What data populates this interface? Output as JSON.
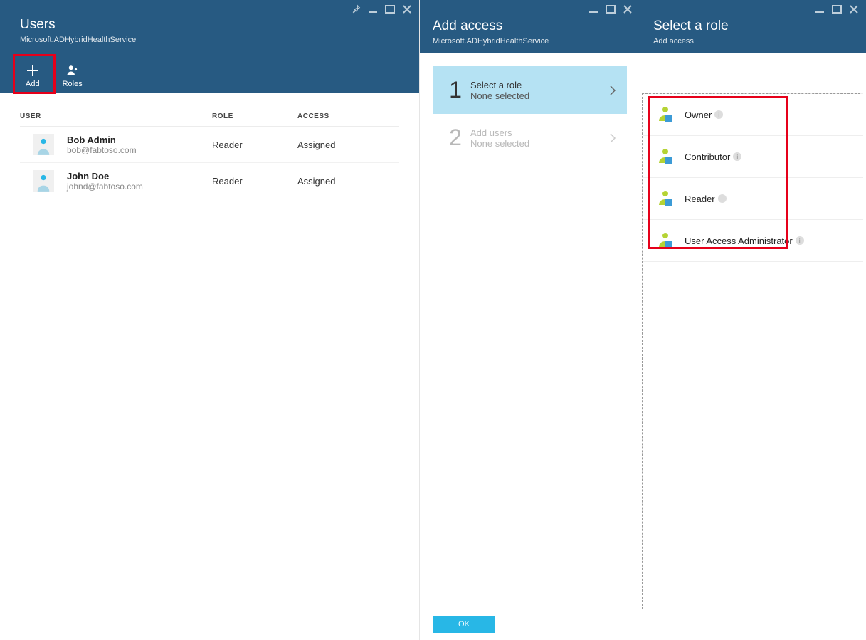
{
  "blade1": {
    "title": "Users",
    "subtitle": "Microsoft.ADHybridHealthService",
    "toolbar": {
      "add": "Add",
      "roles": "Roles"
    },
    "columns": {
      "user": "USER",
      "role": "ROLE",
      "access": "ACCESS"
    },
    "rows": [
      {
        "name": "Bob Admin",
        "email": "bob@fabtoso.com",
        "role": "Reader",
        "access": "Assigned"
      },
      {
        "name": "John Doe",
        "email": "johnd@fabtoso.com",
        "role": "Reader",
        "access": "Assigned"
      }
    ]
  },
  "blade2": {
    "title": "Add access",
    "subtitle": "Microsoft.ADHybridHealthService",
    "steps": [
      {
        "num": "1",
        "title": "Select a role",
        "sub": "None selected",
        "active": true
      },
      {
        "num": "2",
        "title": "Add users",
        "sub": "None selected",
        "active": false
      }
    ],
    "ok": "OK"
  },
  "blade3": {
    "title": "Select a role",
    "subtitle": "Add access",
    "roles": [
      {
        "label": "Owner"
      },
      {
        "label": "Contributor"
      },
      {
        "label": "Reader"
      },
      {
        "label": "User Access Administrator"
      }
    ]
  }
}
